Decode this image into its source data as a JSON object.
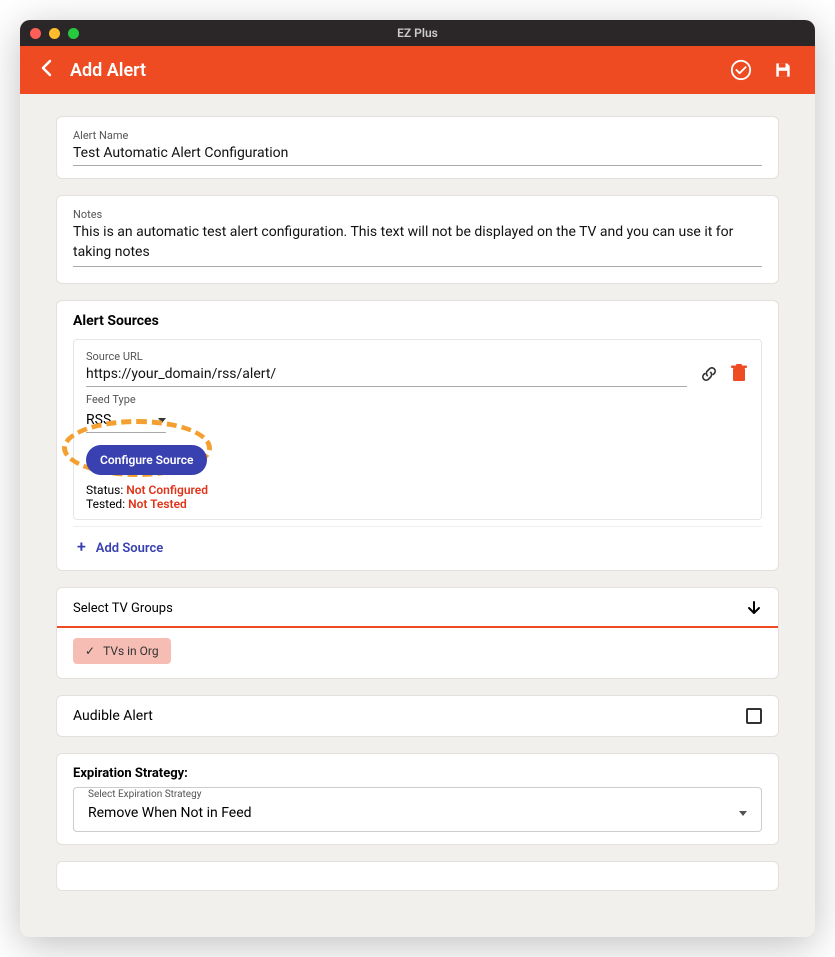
{
  "window": {
    "title": "EZ Plus"
  },
  "header": {
    "title": "Add Alert"
  },
  "alert_name": {
    "label": "Alert Name",
    "value": "Test Automatic Alert Configuration"
  },
  "notes": {
    "label": "Notes",
    "value": "This is an automatic test alert configuration. This text will not be displayed on the TV and you can use it for taking notes"
  },
  "sources": {
    "heading": "Alert Sources",
    "url_label": "Source URL",
    "url_value": "https://your_domain/rss/alert/",
    "feed_label": "Feed Type",
    "feed_value": "RSS",
    "configure_btn": "Configure Source",
    "status_label": "Status:",
    "status_value": "Not Configured",
    "tested_label": "Tested:",
    "tested_value": "Not Tested",
    "add_label": "Add Source"
  },
  "tvgroups": {
    "heading": "Select TV Groups",
    "chip": "TVs in Org"
  },
  "audible": {
    "heading": "Audible Alert"
  },
  "expiration": {
    "heading": "Expiration Strategy:",
    "legend": "Select Expiration Strategy",
    "value": "Remove When Not in Feed"
  }
}
